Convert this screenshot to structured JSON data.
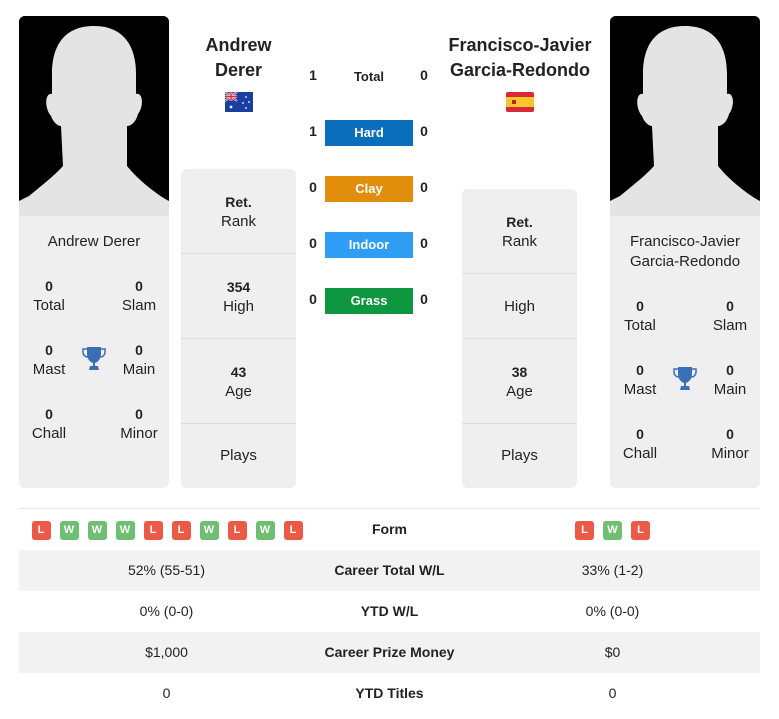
{
  "player1": {
    "name": "Andrew Derer",
    "name_line1": "Andrew",
    "name_line2": "Derer",
    "flag": "australia-flag",
    "titles": {
      "total": {
        "value": "0",
        "label": "Total"
      },
      "slam": {
        "value": "0",
        "label": "Slam"
      },
      "mast": {
        "value": "0",
        "label": "Mast"
      },
      "main": {
        "value": "0",
        "label": "Main"
      },
      "chall": {
        "value": "0",
        "label": "Chall"
      },
      "minor": {
        "value": "0",
        "label": "Minor"
      }
    },
    "info": {
      "rank": {
        "value": "Ret.",
        "label": "Rank"
      },
      "high": {
        "value": "354",
        "label": "High"
      },
      "age": {
        "value": "43",
        "label": "Age"
      },
      "plays": {
        "value": "",
        "label": "Plays"
      }
    },
    "form": [
      "L",
      "W",
      "W",
      "W",
      "L",
      "L",
      "W",
      "L",
      "W",
      "L"
    ]
  },
  "player2": {
    "name": "Francisco-Javier Garcia-Redondo",
    "name_line1": "Francisco-Javier",
    "name_line2": "Garcia-Redondo",
    "flag": "spain-flag",
    "titles": {
      "total": {
        "value": "0",
        "label": "Total"
      },
      "slam": {
        "value": "0",
        "label": "Slam"
      },
      "mast": {
        "value": "0",
        "label": "Mast"
      },
      "main": {
        "value": "0",
        "label": "Main"
      },
      "chall": {
        "value": "0",
        "label": "Chall"
      },
      "minor": {
        "value": "0",
        "label": "Minor"
      }
    },
    "info": {
      "rank": {
        "value": "Ret.",
        "label": "Rank"
      },
      "high": {
        "value": "",
        "label": "High"
      },
      "age": {
        "value": "38",
        "label": "Age"
      },
      "plays": {
        "value": "",
        "label": "Plays"
      }
    },
    "form": [
      "L",
      "W",
      "L"
    ]
  },
  "h2h": {
    "total": {
      "label": "Total",
      "p1": "1",
      "p2": "0"
    },
    "surfaces": [
      {
        "label": "Hard",
        "p1": "1",
        "p2": "0",
        "color": "#0a6ebd"
      },
      {
        "label": "Clay",
        "p1": "0",
        "p2": "0",
        "color": "#e08e0b"
      },
      {
        "label": "Indoor",
        "p1": "0",
        "p2": "0",
        "color": "#2f9df4"
      },
      {
        "label": "Grass",
        "p1": "0",
        "p2": "0",
        "color": "#0e9640"
      }
    ]
  },
  "comparison": {
    "form_label": "Form",
    "rows": [
      {
        "label": "Career Total W/L",
        "p1": "52% (55-51)",
        "p2": "33% (1-2)"
      },
      {
        "label": "YTD W/L",
        "p1": "0% (0-0)",
        "p2": "0% (0-0)"
      },
      {
        "label": "Career Prize Money",
        "p1": "$1,000",
        "p2": "$0"
      },
      {
        "label": "YTD Titles",
        "p1": "0",
        "p2": "0"
      }
    ]
  }
}
